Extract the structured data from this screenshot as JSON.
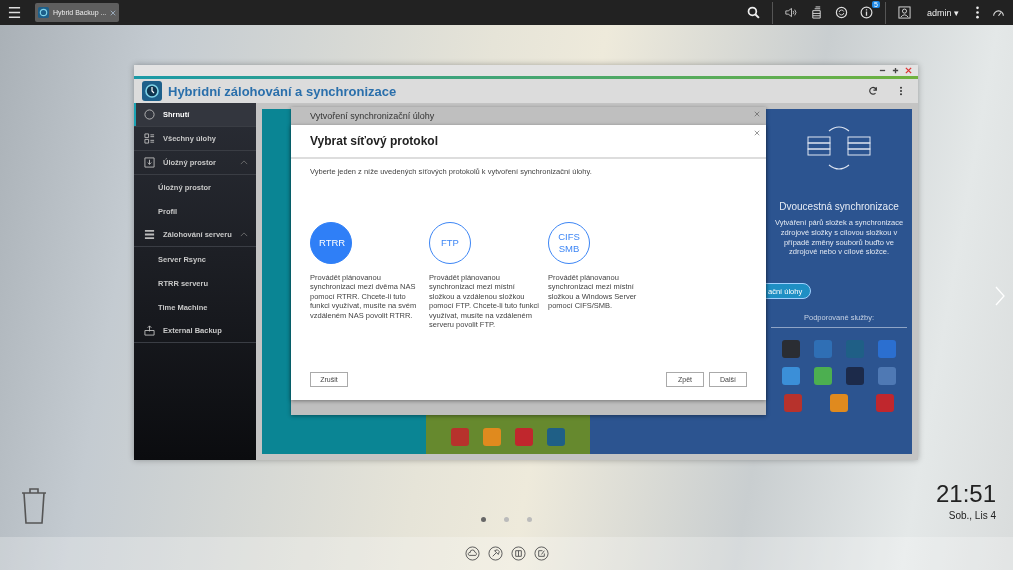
{
  "taskbar": {
    "tab": {
      "label": "Hybrid Backup ...",
      "selected": true
    },
    "notification_badge": "5",
    "user": "admin ▾"
  },
  "app": {
    "title": "Hybridní zálohování a synchronizace",
    "sidebar": [
      {
        "label": "Shrnutí",
        "selected": true
      },
      {
        "label": "Všechny úlohy",
        "selected": false
      },
      {
        "label": "Úložný prostor",
        "selected": false,
        "expanded": true,
        "children": [
          {
            "label": "Úložný prostor",
            "selected": false
          },
          {
            "label": "Profil",
            "selected": false
          }
        ]
      },
      {
        "label": "Zálohování serveru",
        "selected": false,
        "expanded": true,
        "children": [
          {
            "label": "Server Rsync",
            "selected": false
          },
          {
            "label": "RTRR serveru",
            "selected": false
          },
          {
            "label": "Time Machine",
            "selected": false
          }
        ]
      },
      {
        "label": "External Backup",
        "selected": false
      }
    ],
    "sync_panel": {
      "title": "Dvoucestná synchronizace",
      "description": "Vytváření párů složek a synchronizace zdrojové složky s cílovou složkou v případě změny souborů buďto ve zdrojové nebo v cílové složce.",
      "button": "ační úlohy",
      "services_label": "Podporované služby:"
    }
  },
  "back_dialog": {
    "title": "Vytvoření synchronizační úlohy"
  },
  "dialog": {
    "title": "Vybrat síťový protokol",
    "intro": "Vyberte jeden z níže uvedených síťových protokolů k vytvoření synchronizační úlohy.",
    "protocols": [
      {
        "label": "RTRR",
        "selected": true,
        "description": "Provádět plánovanou synchronizaci mezi dvěma NAS pomocí RTRR. Chcete-li tuto funkci využívat, musíte na svém vzdáleném NAS povolit RTRR."
      },
      {
        "label": "FTP",
        "selected": false,
        "description": "Provádět plánovanou synchronizaci mezi místní složkou a vzdálenou složkou pomocí FTP. Chcete-li tuto funkci využívat, musíte na vzdáleném serveru povolit FTP."
      },
      {
        "label": "CIFS SMB",
        "selected": false,
        "description": "Provádět plánovanou synchronizaci mezi místní složkou a Windows Server pomocí CIFS/SMB."
      }
    ],
    "cancel": "Zrušit",
    "back": "Zpět",
    "next": "Další"
  },
  "desktop": {
    "time": "21:51",
    "date": "Sob., Lis 4",
    "pages": [
      {
        "selected": true
      },
      {
        "selected": false
      },
      {
        "selected": false
      }
    ]
  }
}
